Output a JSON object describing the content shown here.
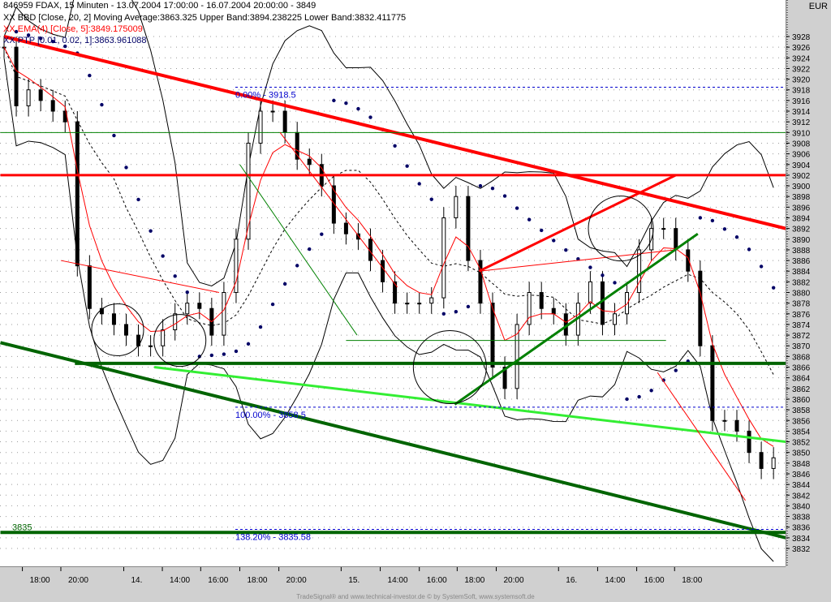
{
  "header": {
    "title": "846959  FDAX, 15 Minuten - 13.07.2004 17:00:00 - 16.07.2004 20:00:00 - 3849",
    "bbd": "XX BBD [Close, 20, 2] Moving Average:3863.325 Upper Band:3894.238225 Lower Band:3832.411775",
    "ema": "XX EMA(4) [Close, 5]:3849.175009",
    "ptp": "XX PTP [0.01, 0.02, 1]:3863.961088"
  },
  "currency": "EUR",
  "footer": "TradeSignal® and www.technical-investor.de © by SystemSoft, www.systemsoft.de",
  "colors": {
    "red": "#ff0000",
    "darkgreen": "#006400",
    "green": "#008000",
    "lime": "#33ee33",
    "blue": "#0000cc",
    "navy": "#000066"
  },
  "chart_data": {
    "type": "candlestick",
    "title": "846959 FDAX, 15 Minuten",
    "ylim": [
      3831,
      3934
    ],
    "y_ticks": [
      3832,
      3834,
      3836,
      3838,
      3840,
      3842,
      3844,
      3846,
      3848,
      3850,
      3852,
      3854,
      3856,
      3858,
      3860,
      3862,
      3864,
      3866,
      3868,
      3870,
      3872,
      3874,
      3876,
      3878,
      3880,
      3882,
      3884,
      3886,
      3888,
      3890,
      3892,
      3894,
      3896,
      3898,
      3900,
      3902,
      3904,
      3906,
      3908,
      3910,
      3912,
      3914,
      3916,
      3918,
      3920,
      3922,
      3924,
      3926,
      3928
    ],
    "x_ticks": [
      {
        "i": 1.5,
        "label": "18:00"
      },
      {
        "i": 4.65,
        "label": "20:00"
      },
      {
        "i": 9.8,
        "label": "14."
      },
      {
        "i": 12.96,
        "label": "14:00"
      },
      {
        "i": 16.1,
        "label": "16:00"
      },
      {
        "i": 19.3,
        "label": "18:00"
      },
      {
        "i": 22.5,
        "label": "20:00"
      },
      {
        "i": 27.6,
        "label": "15."
      },
      {
        "i": 30.8,
        "label": "14:00"
      },
      {
        "i": 34,
        "label": "16:00"
      },
      {
        "i": 37.1,
        "label": "18:00"
      },
      {
        "i": 40.3,
        "label": "20:00"
      },
      {
        "i": 45.4,
        "label": "16."
      },
      {
        "i": 48.6,
        "label": "14:00"
      },
      {
        "i": 51.8,
        "label": "16:00"
      },
      {
        "i": 54.9,
        "label": "18:00"
      }
    ],
    "closes": [
      3926,
      3915,
      3918,
      3916,
      3914,
      3912,
      3885,
      3877,
      3876,
      3874,
      3872,
      3870,
      3870,
      3873,
      3876,
      3878,
      3877,
      3872,
      3880,
      3890,
      3908,
      3914,
      3914,
      3910,
      3905,
      3904,
      3900,
      3893,
      3891,
      3890,
      3886,
      3882,
      3878,
      3878,
      3878,
      3879,
      3894,
      3898,
      3886,
      3878,
      3866,
      3862,
      3874,
      3880,
      3877,
      3876,
      3872,
      3878,
      3882,
      3874,
      3876,
      3880,
      3888,
      3892,
      3892,
      3888,
      3884,
      3870,
      3856,
      3856,
      3854,
      3850,
      3847,
      3849
    ],
    "lines": [
      {
        "name": "red-downtrend",
        "color": "#ff0000",
        "w": 4,
        "p": [
          [
            0,
            3928
          ],
          [
            64,
            3892
          ]
        ]
      },
      {
        "name": "red-resistance-3902",
        "color": "#ff0000",
        "w": 3,
        "p": [
          [
            -0.3,
            3902
          ],
          [
            64,
            3902
          ]
        ]
      },
      {
        "name": "green-line-3910",
        "color": "#008000",
        "w": 1,
        "p": [
          [
            -0.3,
            3910
          ],
          [
            64,
            3910
          ]
        ]
      },
      {
        "name": "support-3867",
        "color": "#006400",
        "w": 4,
        "p": [
          [
            5.8,
            3866.7
          ],
          [
            64,
            3866.7
          ]
        ]
      },
      {
        "name": "dark-green-downtrend",
        "color": "#006400",
        "w": 4,
        "p": [
          [
            -0.3,
            3870.6
          ],
          [
            64,
            3834
          ]
        ]
      },
      {
        "name": "lime-trend",
        "color": "#33ee33",
        "w": 3,
        "p": [
          [
            12.3,
            3866
          ],
          [
            64,
            3852
          ]
        ]
      },
      {
        "name": "support-3835",
        "color": "#006400",
        "w": 4,
        "p": [
          [
            -0.3,
            3835
          ],
          [
            64,
            3835
          ]
        ]
      },
      {
        "name": "red-rising-channel",
        "color": "#ff0000",
        "w": 3,
        "p": [
          [
            38.9,
            3884
          ],
          [
            55,
            3902
          ]
        ]
      },
      {
        "name": "red-thin-rising",
        "color": "#ff0000",
        "w": 1,
        "p": [
          [
            38.9,
            3884
          ],
          [
            55,
            3888
          ]
        ]
      },
      {
        "name": "green-rising",
        "color": "#008000",
        "w": 3,
        "p": [
          [
            36.9,
            3859
          ],
          [
            56.8,
            3891
          ]
        ]
      },
      {
        "name": "green-thin-3871",
        "color": "#008000",
        "w": 1,
        "p": [
          [
            28,
            3871
          ],
          [
            54.2,
            3871
          ]
        ]
      },
      {
        "name": "red-thin-1",
        "color": "#ff0000",
        "w": 1,
        "p": [
          [
            4.65,
            3886
          ],
          [
            17.6,
            3880
          ]
        ]
      },
      {
        "name": "red-thin-2",
        "color": "#ff0000",
        "w": 1,
        "p": [
          [
            22.6,
            3910
          ],
          [
            32.2,
            3881
          ]
        ]
      },
      {
        "name": "green-thin-2",
        "color": "#008000",
        "w": 1,
        "p": [
          [
            19.3,
            3904
          ],
          [
            28.9,
            3872
          ]
        ]
      },
      {
        "name": "red-thin-3",
        "color": "#ff0000",
        "w": 1,
        "p": [
          [
            53.5,
            3865
          ],
          [
            60.7,
            3841
          ]
        ]
      }
    ],
    "fib": [
      {
        "label": "0.00% - 3918.5",
        "value": 3918.5
      },
      {
        "label": "100.00% - 3858.5",
        "value": 3858.5
      },
      {
        "label": "138.20% - 3835.58",
        "value": 3835.58
      }
    ],
    "level_label": {
      "label": "3835",
      "value": 3835
    },
    "circles": [
      [
        9.3,
        3873
      ],
      [
        14.4,
        3871
      ],
      [
        36.5,
        3866
      ],
      [
        50.5,
        3892
      ]
    ]
  }
}
